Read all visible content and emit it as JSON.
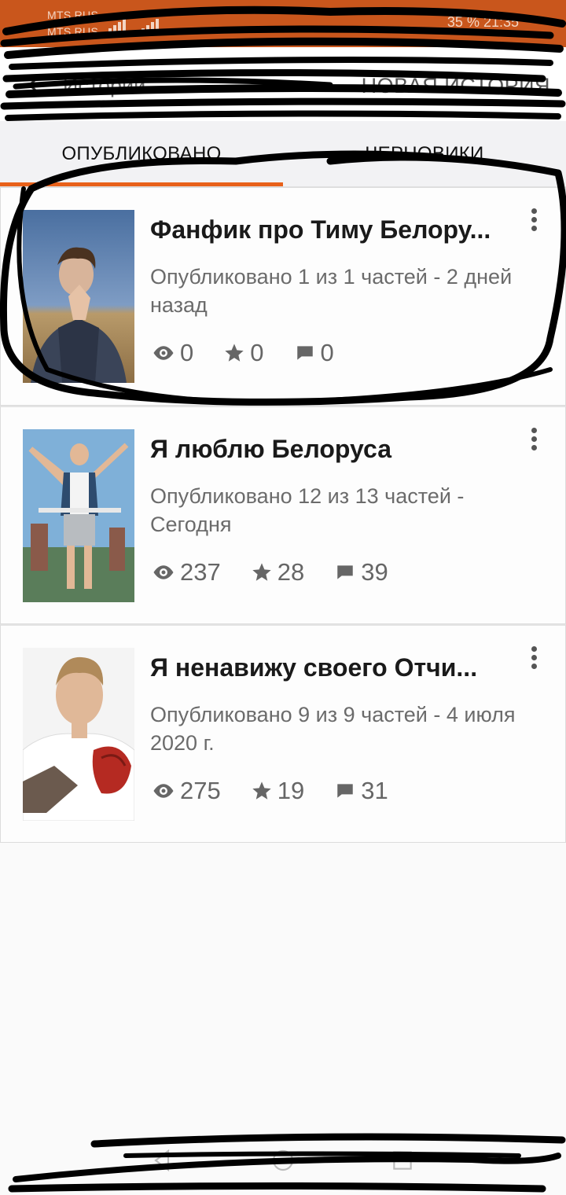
{
  "status_bar": {
    "carrier_1": "MTS RUS",
    "carrier_2": "MTS RUS",
    "right_info": "35 %  21:35"
  },
  "app_bar": {
    "title": "Истории",
    "action": "НОВАЯ ИСТОРИЯ"
  },
  "tabs": [
    {
      "label": "ОПУБЛИКОВАНО",
      "active": true
    },
    {
      "label": "ЧЕРНОВИКИ",
      "active": false
    }
  ],
  "colors": {
    "accent": "#e8611a",
    "status_bar": "#c9561c"
  },
  "stories": [
    {
      "title": "Фанфик про Тиму Белору...",
      "meta": "Опубликовано 1 из 1 частей - 2 дней назад",
      "views": "0",
      "votes": "0",
      "comments": "0"
    },
    {
      "title": "Я люблю Белоруса",
      "meta": "Опубликовано 12 из 13 частей - Сегодня",
      "views": "237",
      "votes": "28",
      "comments": "39"
    },
    {
      "title": " Я ненавижу своего Отчи...",
      "meta": "Опубликовано 9 из 9 частей - 4 июля 2020 г.",
      "views": "275",
      "votes": "19",
      "comments": "31"
    }
  ],
  "icons": {
    "views": "eye-icon",
    "votes": "star-icon",
    "comments": "comment-icon",
    "more": "more-vertical-icon",
    "back": "arrow-left-icon"
  }
}
